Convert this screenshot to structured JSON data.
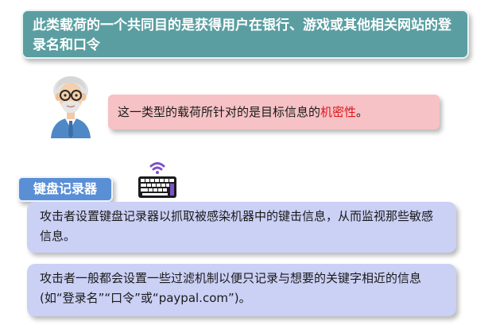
{
  "title": "此类载荷的一个共同目的是获得用户在银行、游戏或其他相关网站的登录名和口令",
  "callout": {
    "prefix": "这一类型的载荷所针对的是目标信息的",
    "highlight": "机密性",
    "suffix": "。"
  },
  "keylogger_label": "键盘记录器",
  "descriptions": [
    "攻击者设置键盘记录器以抓取被感染机器中的键击信息，从而监视那些敏感信息。",
    "攻击者一般都会设置一些过滤机制以便只记录与想要的关键字相近的信息(如“登录名”“口令”或“paypal.com”)。"
  ],
  "colors": {
    "title_bg": "#5a9ea1",
    "callout_bg": "#f6c2c5",
    "callout_highlight": "#e0151a",
    "label_bg": "#5a8fd6",
    "desc_bg": "#cbd0f5"
  },
  "icons": [
    "old-man-avatar-icon",
    "wireless-keyboard-icon"
  ]
}
